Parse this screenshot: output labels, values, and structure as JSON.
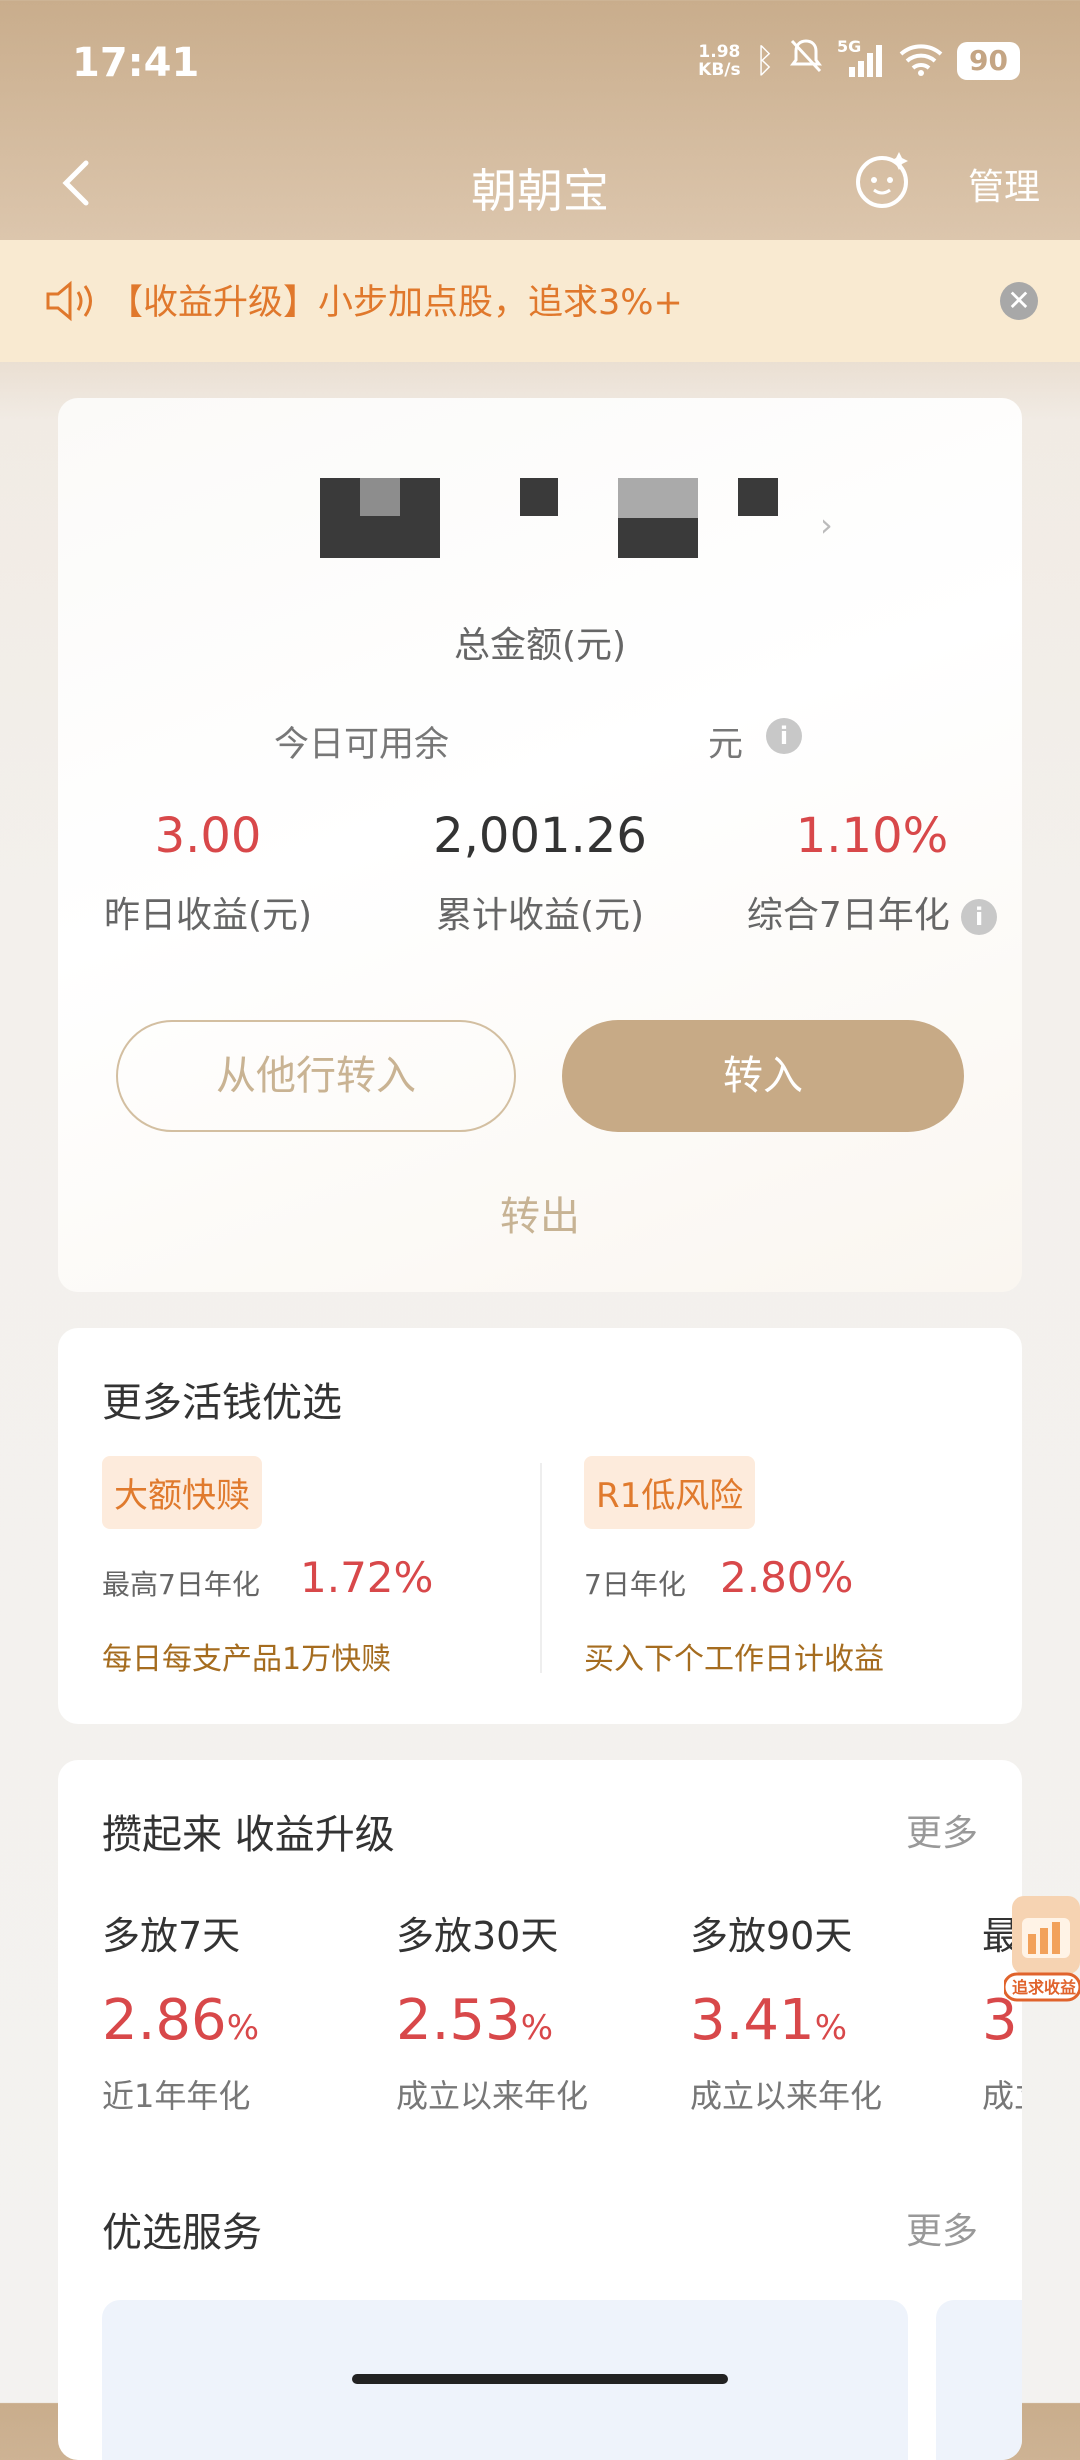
{
  "status_bar": {
    "time": "17:41",
    "net_speed_value": "1.98",
    "net_speed_unit": "KB/s",
    "signal_label": "5G",
    "battery": "90"
  },
  "nav": {
    "title": "朝朝宝",
    "manage_label": "管理"
  },
  "notice": {
    "text": "【收益升级】小步加点股，追求3%+"
  },
  "account": {
    "total_label": "总金额(元)",
    "available_label": "今日可用余",
    "available_unit": "元",
    "yesterday_value": "3.00",
    "yesterday_label": "昨日收益(元)",
    "cumulative_value": "2,001.26",
    "cumulative_label": "累计收益(元)",
    "annual_value": "1.10%",
    "annual_label": "综合7日年化",
    "btn_other_bank": "从他行转入",
    "btn_transfer_in": "转入",
    "transfer_out": "转出"
  },
  "picks": {
    "title": "更多活钱优选",
    "items": [
      {
        "tag": "大额快赎",
        "rate_label": "最高7日年化",
        "rate": "1.72%",
        "desc": "每日每支产品1万快赎"
      },
      {
        "tag": "R1低风险",
        "rate_label": "7日年化",
        "rate": "2.80%",
        "desc": "买入下个工作日计收益"
      }
    ]
  },
  "upgrade": {
    "title": "攒起来 收益升级",
    "more": "更多",
    "terms": [
      {
        "title": "多放7天",
        "rate": "2.86",
        "unit": "%",
        "desc": "近1年年化"
      },
      {
        "title": "多放30天",
        "rate": "2.53",
        "unit": "%",
        "desc": "成立以来年化"
      },
      {
        "title": "多放90天",
        "rate": "3.41",
        "unit": "%",
        "desc": "成立以来年化"
      },
      {
        "title": "最",
        "rate": "3.",
        "unit": "",
        "desc": "成立"
      }
    ],
    "services_title": "优选服务",
    "services_more": "更多"
  },
  "float_badge": {
    "text": "追求收益"
  }
}
